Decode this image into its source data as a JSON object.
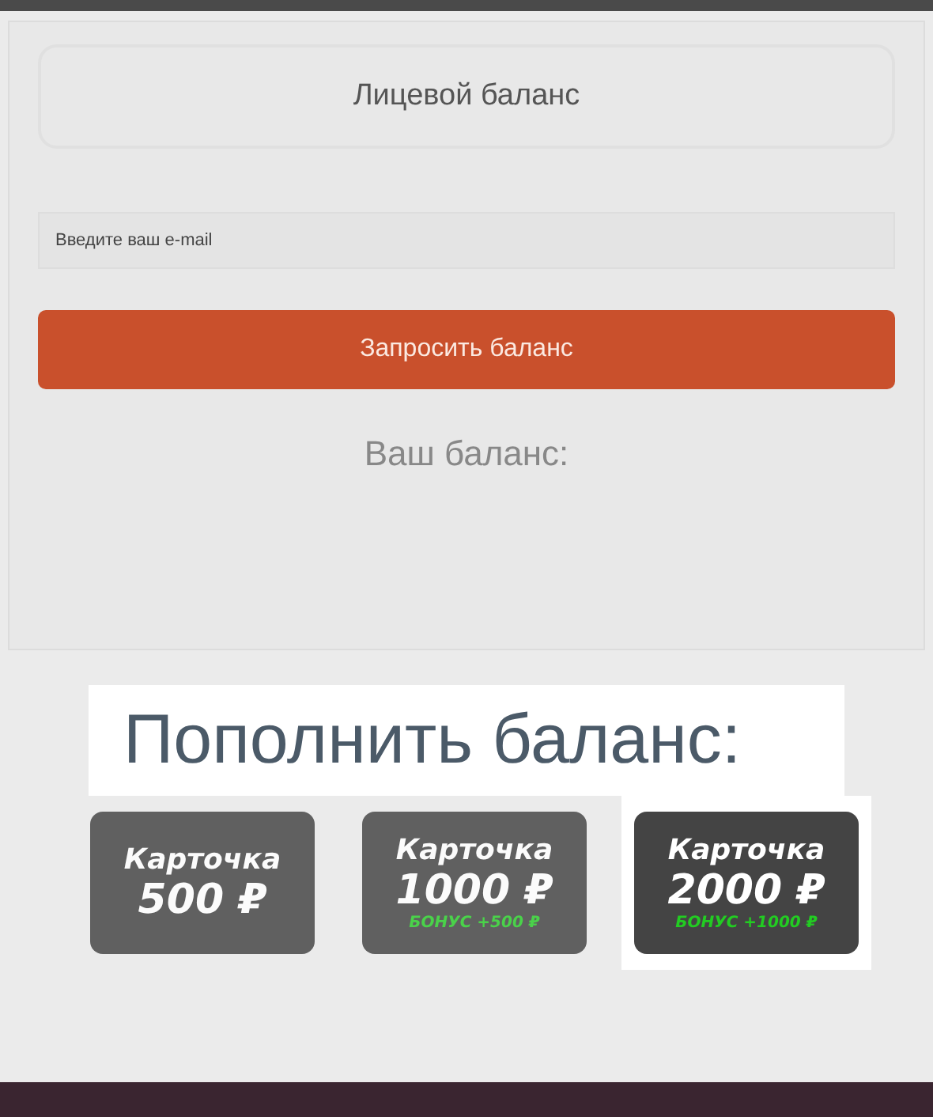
{
  "balance_panel": {
    "title": "Лицевой баланс",
    "email_field": {
      "placeholder": "Введите ваш e-mail"
    },
    "button": "Запросить баланс",
    "balance_label": "Ваш баланс:"
  },
  "topup": {
    "heading": "Пополнить баланс:",
    "cards": [
      {
        "title": "Карточка",
        "amount": "500 ₽",
        "selected": false
      },
      {
        "title": "Карточка",
        "amount": "1000 ₽",
        "bonus": "БОНУС +500 ₽",
        "selected": false
      },
      {
        "title": "Карточка",
        "amount": "2000 ₽",
        "bonus": "БОНУС +1000 ₽",
        "selected": true
      }
    ]
  }
}
